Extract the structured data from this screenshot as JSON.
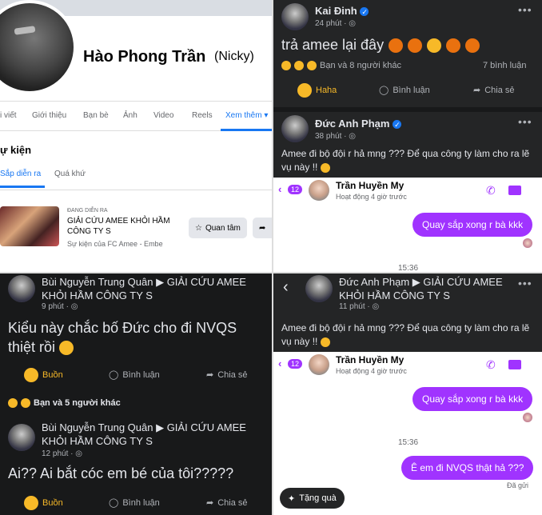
{
  "q1": {
    "profile_name": "Hào Phong Trần",
    "nickname": "(Nicky)",
    "tabs": [
      "i viết",
      "Giới thiệu",
      "Bạn bè",
      "Ảnh",
      "Video",
      "Reels",
      "Xem thêm ▾"
    ],
    "section_title": "ự kiện",
    "subtabs": [
      "Sắp diễn ra",
      "Quá khứ"
    ],
    "event": {
      "status": "ĐANG DIỄN RA",
      "title": "GIẢI CỨU AMEE KHỎI HẦM CÔNG TY S",
      "by": "Sự kiện của FC Amee - Embe",
      "interested_label": "Quan tâm",
      "share_icon": "share-arrow-icon"
    }
  },
  "q2": {
    "post1": {
      "author": "Kai Đinh",
      "time": "24 phút · ",
      "text": "trả amee lại đây",
      "reactions_text": "Bạn và 8 người khác",
      "comments_count": "7 bình luận",
      "actions": [
        "Haha",
        "Bình luận",
        "Chia sẻ"
      ]
    },
    "post2": {
      "author": "Đức Anh Phạm",
      "time": "38 phút · ",
      "text": "Amee đi bộ đội r hả mng ??? Để qua công ty làm cho ra lẽ vụ này !!"
    },
    "messenger": {
      "badge": "12",
      "contact": "Trần Huyền My",
      "status": "Hoạt động 4 giờ trước",
      "msg1": "Quay sắp xong r bà kkk",
      "time_partial": "15:36"
    }
  },
  "q3": {
    "post1": {
      "author": "Bùi Nguyễn Trung Quân ▶ GIẢI CỨU AMEE KHỎI HẦM CÔNG TY S",
      "time": "9 phút · ",
      "text": "Kiểu này chắc bố Đức cho đi NVQS thiệt rồi",
      "actions": [
        "Buồn",
        "Bình luận",
        "Chia sẻ"
      ],
      "reactions_text": "Bạn và 5 người khác"
    },
    "post2": {
      "author": "Bùi Nguyễn Trung Quân ▶ GIẢI CỨU AMEE KHỎI HẦM CÔNG TY S",
      "time": "12 phút · ",
      "text": "Ai?? Ai bắt cóc em bé của tôi?????",
      "actions": [
        "Buồn",
        "Bình luận",
        "Chia sẻ"
      ]
    }
  },
  "q4": {
    "post": {
      "author": "Đức Anh Phạm ▶ GIẢI CỨU AMEE KHỎI HẦM CÔNG TY S",
      "time": "11 phút · ",
      "text": "Amee đi bộ đội r hả mng ??? Để qua công ty làm cho ra lẽ vụ này !!"
    },
    "messenger": {
      "badge": "12",
      "contact": "Trần Huyền My",
      "status": "Hoạt động 4 giờ trước",
      "msg1": "Quay sắp xong r bà kkk",
      "time": "15:36",
      "msg2": "Ê em đi NVQS thật hả ???",
      "sent_label": "Đã gửi",
      "gift_label": "Tặng quà"
    }
  },
  "colors": {
    "fb_blue": "#1877f2",
    "messenger_purple": "#a033ff",
    "dark_bg": "#242526"
  }
}
